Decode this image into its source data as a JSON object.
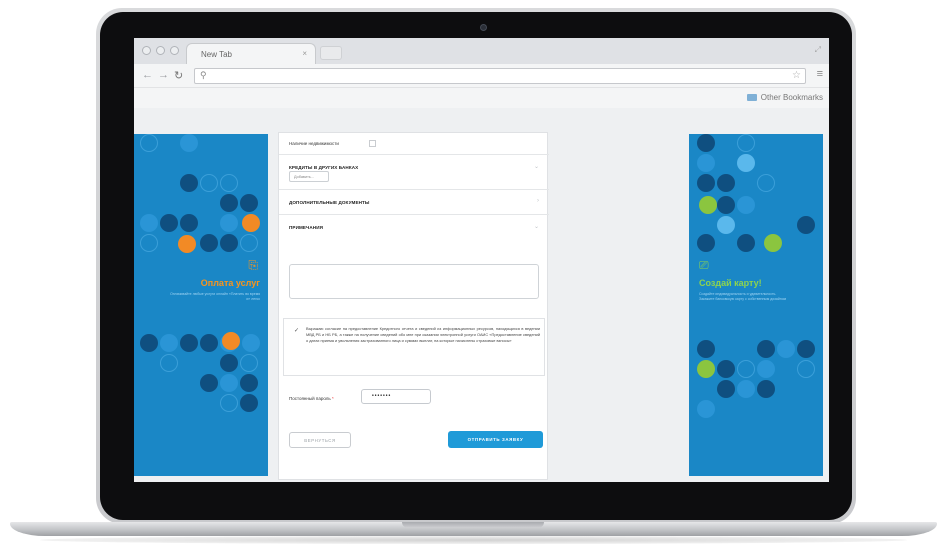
{
  "browser": {
    "tab_title": "New Tab",
    "tab_close": "×",
    "address_value": "",
    "search_icon": "search-icon",
    "bookmarks_label": "Other Bookmarks"
  },
  "form": {
    "property_label": "Наличие недвижимости",
    "credits_section": "КРЕДИТЫ В ДРУГИХ БАНКАХ",
    "add_button": "Добавить...",
    "documents_section": "ДОПОЛНИТЕЛЬНЫЕ ДОКУМЕНТЫ",
    "notes_section": "ПРИМЕЧАНИЯ",
    "consent_text": "Выражаю согласие на предоставление Кредитного отчета и сведений из информационных ресурсов, находящихся в ведении МВД РБ и НБ РБ, а также на получение сведений обо мне при оказании электронной услуги ОАИС «Предоставление сведений о датах приема и увольнения застрахованного лица и суммах выплат, на которые начислены страховые взносы»",
    "password_label": "Постоянный пароль",
    "password_required": "*",
    "password_value": "•••••••",
    "back_button": "ВЕРНУТЬСЯ",
    "submit_button": "ОТПРАВИТЬ ЗАЯВКУ"
  },
  "banners": {
    "left_title": "Оплата услуг",
    "left_text": "Оплачивайте любые услуги онлайн «Платить во время и» легко",
    "right_title": "Создай карту!",
    "right_text": "Создайте индивидуальность и удивительность. Закажите банковскую карту с собственным дизайном"
  },
  "colors": {
    "banner_blue": "#1a87c6",
    "accent_orange": "#f28a25",
    "accent_green": "#8bc53f",
    "button_blue": "#1f9ad8"
  }
}
